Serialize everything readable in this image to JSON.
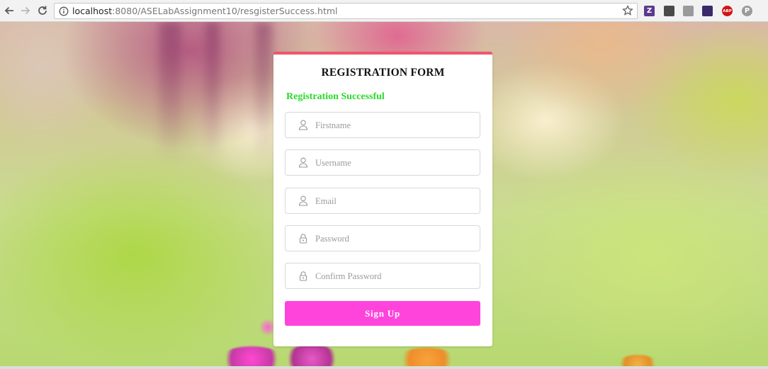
{
  "browser": {
    "url_host": "localhost",
    "url_path": ":8080/ASELabAssignment10/resgisterSuccess.html",
    "back_icon": "back-arrow-icon",
    "forward_icon": "forward-arrow-icon",
    "reload_icon": "reload-icon",
    "info_icon": "info-icon",
    "bookmark_icon": "star-icon",
    "extensions": [
      {
        "name": "zotero-extension",
        "glyph": "Z",
        "color": "#5b3a8f"
      },
      {
        "name": "shield-extension",
        "glyph": "",
        "color": "#4a4a4a"
      },
      {
        "name": "camera-extension",
        "glyph": "",
        "color": "#9a9a9a"
      },
      {
        "name": "purple-extension",
        "glyph": "",
        "color": "#3a2a6a"
      },
      {
        "name": "adblock-extension",
        "glyph": "ABP",
        "color": "#d01515"
      },
      {
        "name": "p-extension",
        "glyph": "P",
        "color": "#9a9a9a"
      }
    ]
  },
  "form": {
    "title": "REGISTRATION FORM",
    "status_message": "Registration Successful",
    "status_color": "#2ad92a",
    "accent_color": "#f0556e",
    "fields": [
      {
        "placeholder": "Firstname",
        "value": "",
        "icon": "user-icon"
      },
      {
        "placeholder": "Username",
        "value": "",
        "icon": "user-icon"
      },
      {
        "placeholder": "Email",
        "value": "",
        "icon": "user-icon"
      },
      {
        "placeholder": "Password",
        "value": "",
        "icon": "lock-icon"
      },
      {
        "placeholder": "Confirm Password",
        "value": "",
        "icon": "lock-icon"
      }
    ],
    "submit_label": "Sign Up",
    "submit_color": "#ff44dc"
  }
}
